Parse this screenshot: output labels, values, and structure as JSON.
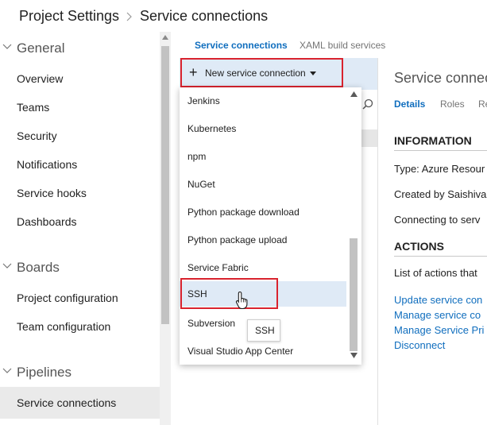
{
  "breadcrumb": {
    "project_settings": "Project Settings",
    "current": "Service connections"
  },
  "sidebar": {
    "sections": [
      {
        "label": "General",
        "items": [
          "Overview",
          "Teams",
          "Security",
          "Notifications",
          "Service hooks",
          "Dashboards"
        ]
      },
      {
        "label": "Boards",
        "items": [
          "Project configuration",
          "Team configuration"
        ]
      },
      {
        "label": "Pipelines",
        "items": [
          "Service connections"
        ]
      }
    ],
    "selected_item": "Service connections"
  },
  "tabs": {
    "active": "Service connections",
    "inactive": "XAML build services"
  },
  "toolbar": {
    "new_connection_label": "New service connection"
  },
  "dropdown": {
    "items": [
      "Jenkins",
      "Kubernetes",
      "npm",
      "NuGet",
      "Python package download",
      "Python package upload",
      "Service Fabric",
      "SSH",
      "Subversion",
      "Visual Studio App Center"
    ],
    "hovered_item": "SSH",
    "tooltip": "SSH"
  },
  "detail": {
    "title": "Service connect",
    "tabs": [
      "Details",
      "Roles",
      "Re"
    ],
    "information_heading": "INFORMATION",
    "info_lines": [
      "Type: Azure Resour",
      "Created by Saishiva",
      "Connecting to serv"
    ],
    "actions_heading": "ACTIONS",
    "actions_text": "List of actions that",
    "links": [
      "Update service con",
      "Manage service co",
      "Manage Service Pri",
      "Disconnect"
    ]
  },
  "colors": {
    "accent": "#106ebe",
    "highlight_border": "#d9232e",
    "hover_bg": "#dfeaf6",
    "selected_bg": "#eaeaea"
  }
}
